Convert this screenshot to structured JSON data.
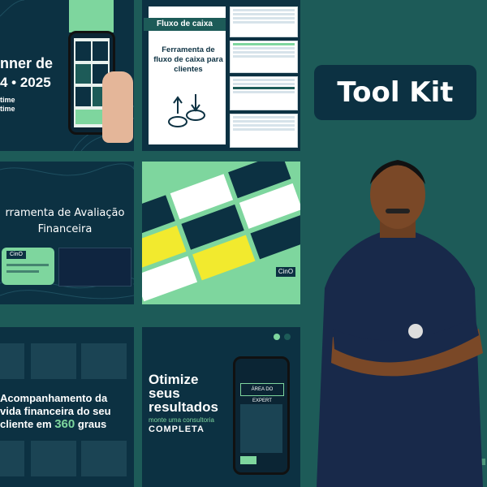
{
  "badge": {
    "text": "Tool Kit"
  },
  "tile1": {
    "title_line1": "nner de",
    "title_line2": "4 • 2025",
    "line1": "time",
    "line2": "time"
  },
  "tile2": {
    "header": "Fluxo de caixa",
    "body": "Ferramenta de fluxo de caixa para clientes"
  },
  "tile3": {
    "title": "rramenta de Avaliação Financeira",
    "logo": "CinO"
  },
  "tile4": {
    "logo": "CinO"
  },
  "tile5": {
    "title_line1": "Acompanhamento da",
    "title_line2": "vida financeira do seu",
    "title_line3_a": "cliente em",
    "title_line3_b": "360",
    "title_line3_c": "graus"
  },
  "tile6": {
    "line1": "Otimize",
    "line2": "seus",
    "line3": "resultados",
    "subtitle": "monte uma consultoria",
    "line4": "COMPLETA",
    "phone_title": "Área do Expert"
  },
  "colors": {
    "navy": "#0c3142",
    "teal_bg": "#1d5b58",
    "mint": "#7ed69e",
    "yellow": "#f2ea2e"
  }
}
